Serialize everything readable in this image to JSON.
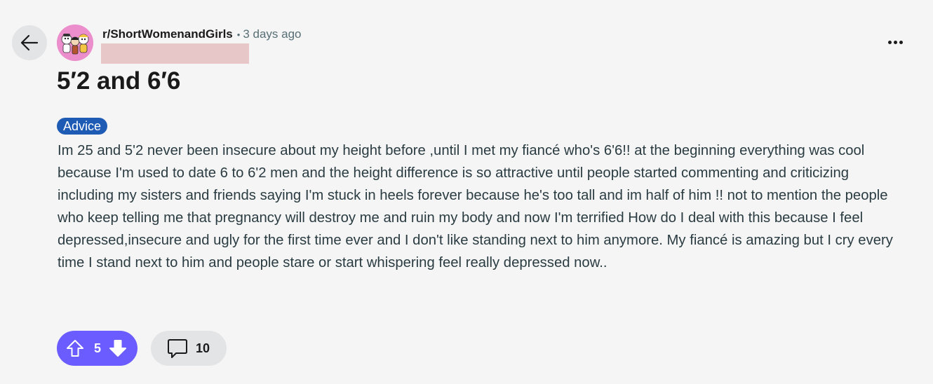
{
  "post": {
    "subreddit": "r/ShortWomenandGirls",
    "separator": "•",
    "time_ago": "3 days ago",
    "title": "5′2 and 6′6",
    "flair": "Advice",
    "body": "Im 25 and 5'2 never been insecure about my height before ,until I met my fiancé who's 6'6!! at the beginning everything was cool because I'm used to date 6 to 6'2 men and the height difference is so attractive until people started commenting and criticizing including my sisters and friends saying I'm stuck in heels forever because he's too tall and im half of him !! not to mention the people who keep telling me that pregnancy will destroy me and ruin my body and now I'm terrified How do I deal with this because I feel depressed,insecure and ugly for the first time ever and I don't like standing next to him anymore. My fiancé is amazing but I cry every time I stand next to him and people stare or start whispering feel really depressed now.."
  },
  "actions": {
    "vote_count": "5",
    "comment_count": "10"
  },
  "icons": {
    "back": "arrow-left-icon",
    "more": "more-horizontal-icon",
    "upvote": "upvote-arrow-icon",
    "downvote": "downvote-arrow-icon",
    "comment": "comment-bubble-icon"
  },
  "colors": {
    "background": "#f5f5f5",
    "flair": "#1d5bb5",
    "vote_active": "#6a5cff",
    "pill_neutral": "#e3e4e6",
    "redaction": "#e8c7c9",
    "avatar_bg": "#eb8ecb"
  }
}
